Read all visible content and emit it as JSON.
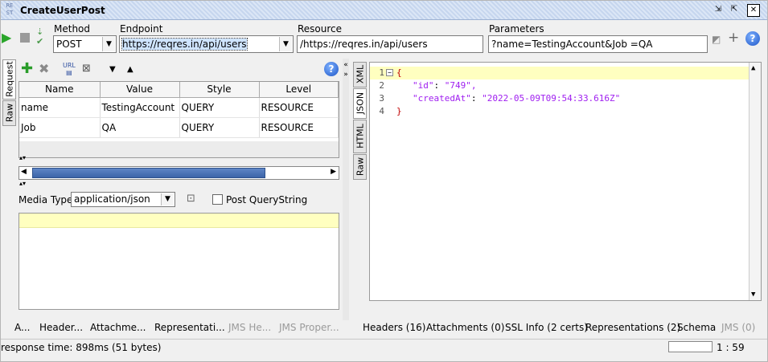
{
  "titlebar": {
    "app_icon_text": "RE ST",
    "title": "CreateUserPost"
  },
  "toolbar": {
    "method_label": "Method",
    "method_value": "POST",
    "endpoint_label": "Endpoint",
    "endpoint_value": "https://reqres.in/api/users",
    "resource_label": "Resource",
    "resource_value": "/https://reqres.in/api/users",
    "parameters_label": "Parameters",
    "parameters_value": "?name=TestingAccount&Job =QA"
  },
  "request": {
    "vtabs": {
      "request": "Request",
      "raw": "Raw"
    },
    "param_table": {
      "columns": [
        "Name",
        "Value",
        "Style",
        "Level"
      ],
      "rows": [
        [
          "name",
          "TestingAccount",
          "QUERY",
          "RESOURCE"
        ],
        [
          "Job",
          "QA",
          "QUERY",
          "RESOURCE"
        ]
      ]
    },
    "media_type_label": "Media Type",
    "media_type_value": "application/json",
    "post_querystring_label": "Post QueryString"
  },
  "response": {
    "vtabs": {
      "xml": "XML",
      "json": "JSON",
      "html": "HTML",
      "raw": "Raw"
    },
    "lines": [
      {
        "num": "1",
        "text": "{"
      },
      {
        "num": "2",
        "key": "\"id\"",
        "value": "\"749\","
      },
      {
        "num": "3",
        "key": "\"createdAt\"",
        "value": "\"2022-05-09T09:54:33.616Z\""
      },
      {
        "num": "4",
        "text": "}"
      }
    ]
  },
  "request_bottom_tabs": [
    "A...",
    "Header...",
    "Attachme...",
    "Representati...",
    "JMS He...",
    "JMS Proper..."
  ],
  "response_bottom_tabs": [
    "Headers (16)",
    "Attachments (0)",
    "SSL Info (2 certs)",
    "Representations (2)",
    "Schema",
    "JMS (0)"
  ],
  "status": {
    "response_time": "response time: 898ms (51 bytes)",
    "cursor_pos": "1 : 59"
  },
  "colors": {
    "json_key": "#a020f0",
    "json_string": "#a020f0",
    "brace": "#c00000",
    "highlight": "#ffffc0"
  }
}
